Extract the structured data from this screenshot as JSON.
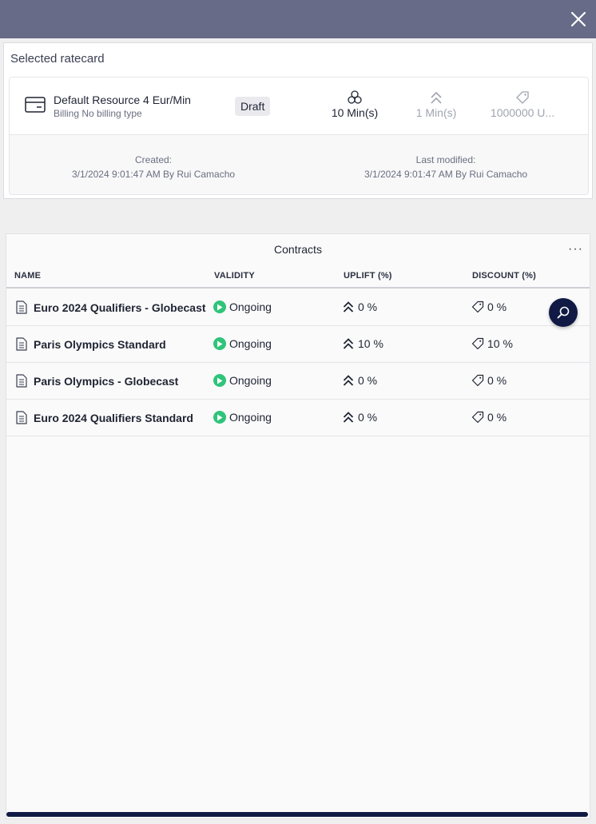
{
  "ratecard": {
    "section_title": "Selected ratecard",
    "name": "Default Resource 4 Eur/Min",
    "billing": "Billing No billing type",
    "status": "Draft",
    "duration": "10 Min(s)",
    "increment": "1 Min(s)",
    "units": "1000000 U...",
    "created_label": "Created:",
    "created_value": "3/1/2024 9:01:47 AM By Rui Camacho",
    "modified_label": "Last modified:",
    "modified_value": "3/1/2024 9:01:47 AM By Rui Camacho"
  },
  "contracts": {
    "title": "Contracts",
    "more_label": "···",
    "columns": {
      "name": "NAME",
      "validity": "VALIDITY",
      "uplift": "UPLIFT (%)",
      "discount": "DISCOUNT (%)"
    },
    "rows": [
      {
        "name": "Euro 2024 Qualifiers - Globecast",
        "validity": "Ongoing",
        "uplift": "0 %",
        "discount": "0 %"
      },
      {
        "name": "Paris Olympics Standard",
        "validity": "Ongoing",
        "uplift": "10 %",
        "discount": "10 %"
      },
      {
        "name": "Paris Olympics - Globecast",
        "validity": "Ongoing",
        "uplift": "0 %",
        "discount": "0 %"
      },
      {
        "name": "Euro 2024 Qualifiers Standard",
        "validity": "Ongoing",
        "uplift": "0 %",
        "discount": "0 %"
      }
    ]
  },
  "icons": {
    "close": "close-icon",
    "billing": "credit-card-icon",
    "duration": "coins-icon",
    "increment": "double-chevron-up-icon",
    "units": "tag-icon",
    "document": "document-icon",
    "status": "play-circle-icon",
    "uplift": "double-chevron-up-icon",
    "discount": "tag-icon",
    "search": "search-icon"
  },
  "colors": {
    "topbar": "#686b88",
    "accent": "#111a44",
    "ongoing": "#2fc47a"
  }
}
